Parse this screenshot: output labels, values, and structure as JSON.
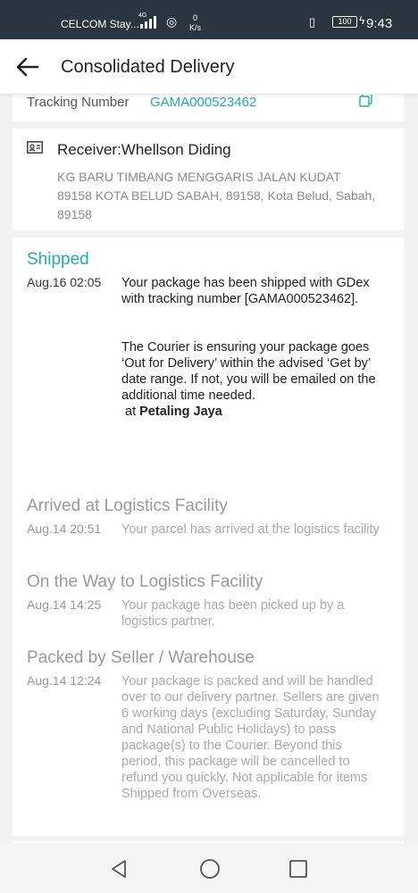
{
  "status_bar": {
    "carrier": "CELCOM Stay...",
    "network_type": "4G",
    "speed_value": "0",
    "speed_unit": "K/s",
    "battery": "100",
    "time": "9:43"
  },
  "header": {
    "title": "Consolidated Delivery",
    "back_icon": "arrow-left-icon"
  },
  "tracking": {
    "label": "Tracking Number",
    "number": "GAMA000523462"
  },
  "receiver": {
    "name_line": "Receiver:Whellson Diding",
    "address": "KG BARU TIMBANG MENGGARIS JALAN KUDAT 89158 KOTA BELUD SABAH, 89158, Kota Belud, Sabah, 89158"
  },
  "timeline": [
    {
      "title": "Shipped",
      "time": "Aug.16 02:05",
      "text_1": "Your package has been shipped with GDex with tracking number [GAMA000523462].",
      "text_2": "The Courier is ensuring your package goes ‘Out for Delivery’ within the advised ‘Get by’ date range. If not, you will be emailed on the additional time needed.",
      "location_prefix": "at",
      "location": "Petaling Jaya"
    },
    {
      "title": "Arrived at Logistics Facility",
      "time": "Aug.14 20:51",
      "text": "Your parcel has arrived at the logistics facility"
    },
    {
      "title": "On the Way to Logistics Facility",
      "time": "Aug.14 14:25",
      "text": "Your package has been picked up by a logistics partner."
    },
    {
      "title": "Packed by Seller / Warehouse",
      "time": "Aug.14 12:24",
      "text": "Your package is packed and will be handled over to our delivery partner. Sellers are given 6 working days (excluding Saturday, Sunday and National Public Holidays) to pass package(s) to the Courier. Beyond this period, this package will be cancelled to refund you quickly. Not applicable for items Shipped from Overseas."
    }
  ],
  "colors": {
    "accent": "#26a8a8",
    "status_bar": "#2b3540",
    "muted_text": "#999999"
  }
}
